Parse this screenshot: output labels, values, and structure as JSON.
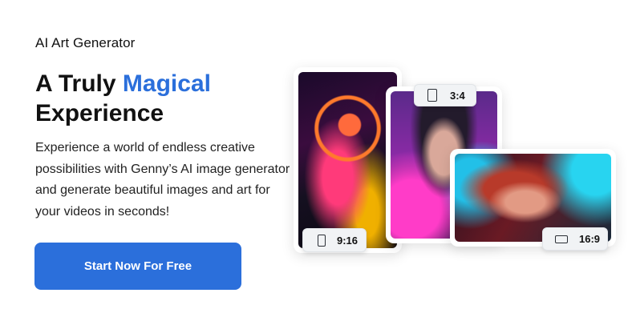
{
  "hero": {
    "eyebrow": "AI Art Generator",
    "title_part1": "A Truly ",
    "title_accent": "Magical",
    "title_part2": "Experience",
    "description": "Experience a world of endless creative possibilities with Genny’s AI image generator and generate beautiful images and art for your videos in seconds!",
    "cta_label": "Start Now For Free"
  },
  "gallery": {
    "cards": [
      {
        "ratio_label": "9:16",
        "icon": "portrait-ratio-icon"
      },
      {
        "ratio_label": "3:4",
        "icon": "portrait-ratio-icon"
      },
      {
        "ratio_label": "16:9",
        "icon": "landscape-ratio-icon"
      }
    ]
  },
  "colors": {
    "accent": "#2b6fdb",
    "text": "#111111",
    "background": "#ffffff"
  }
}
